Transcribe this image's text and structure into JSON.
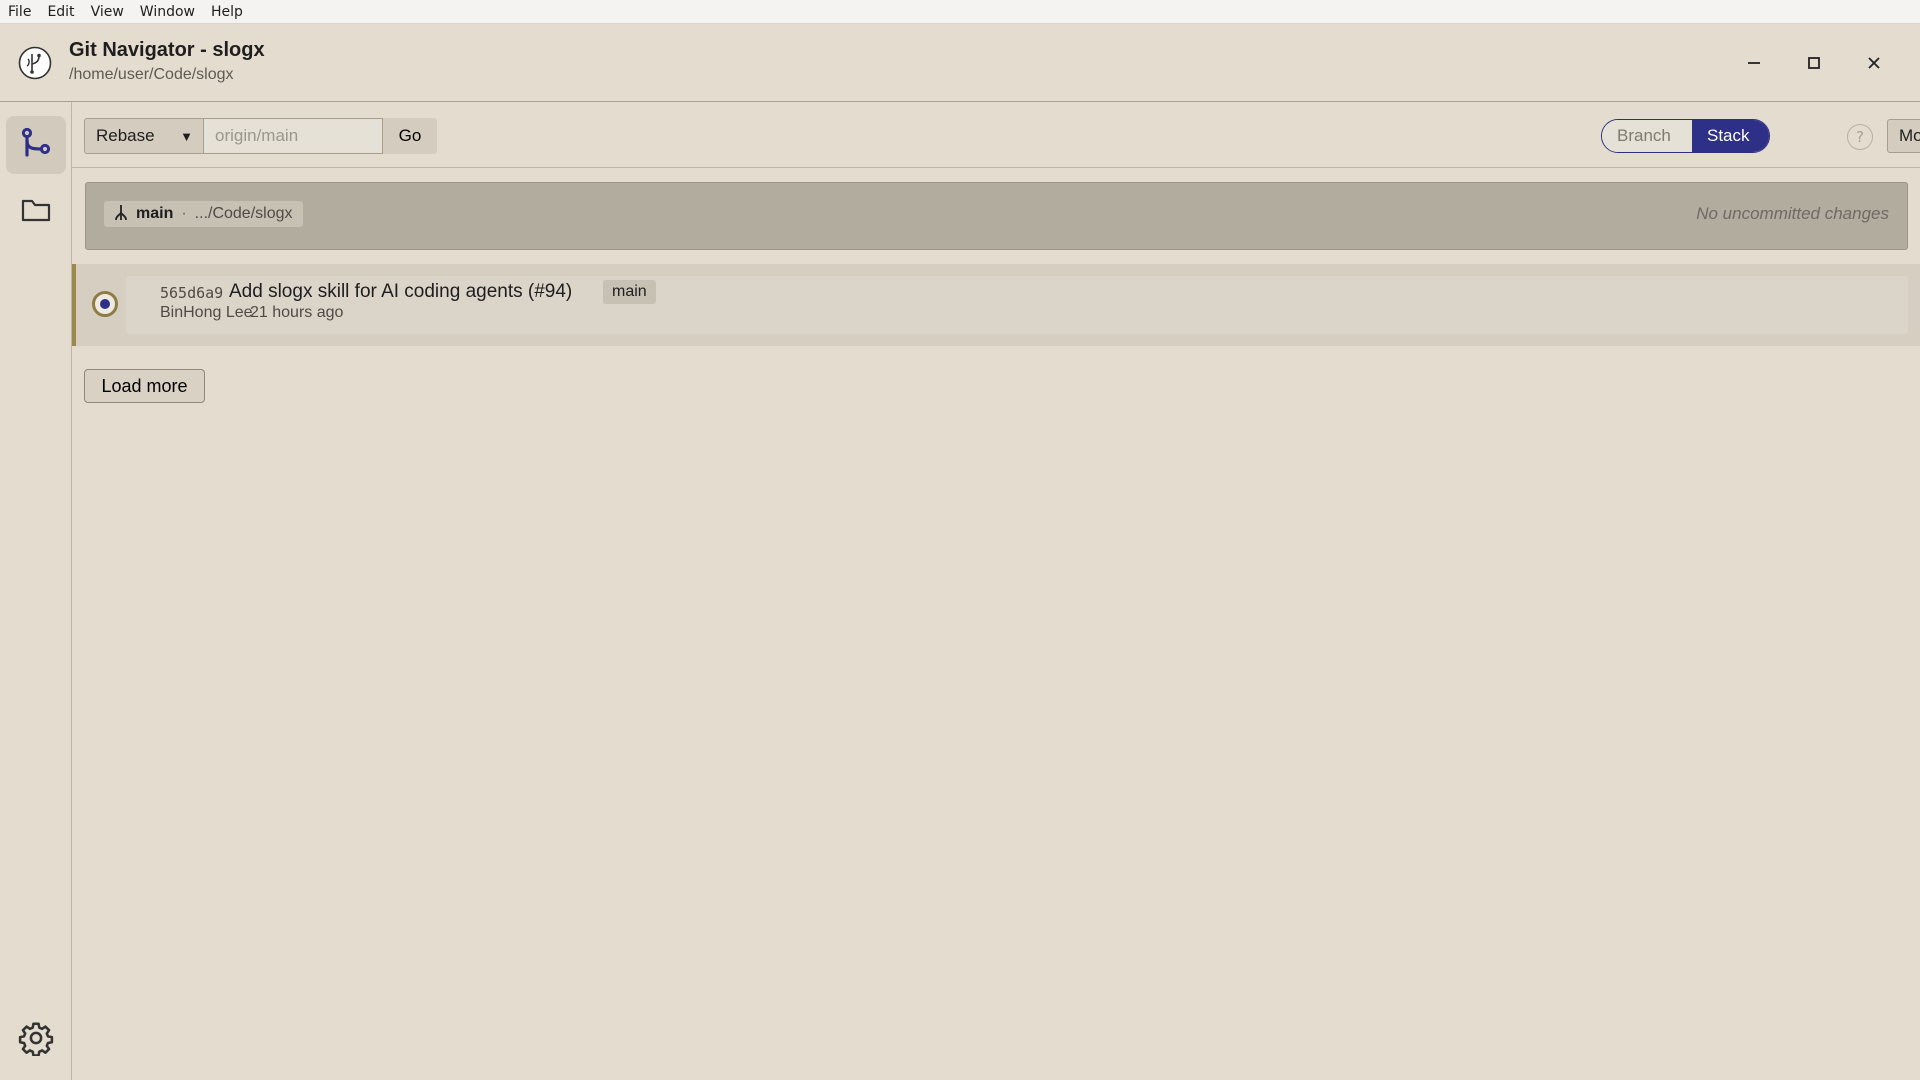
{
  "menubar": {
    "items": [
      "File",
      "Edit",
      "View",
      "Window",
      "Help"
    ]
  },
  "window": {
    "title": "Git Navigator - slogx",
    "path": "/home/user/Code/slogx"
  },
  "toolbar": {
    "mode": "Rebase",
    "target_placeholder": "origin/main",
    "go_label": "Go",
    "view_branch": "Branch",
    "view_stack": "Stack",
    "view_active": "Stack",
    "help_label": "?",
    "more_label": "More"
  },
  "workspace": {
    "branch": "main",
    "separator": "·",
    "path": ".../Code/slogx",
    "status": "No uncommitted changes"
  },
  "commits": [
    {
      "hash": "565d6a9",
      "message": "Add slogx skill for AI coding agents (#94)",
      "ref": "main",
      "author": "BinHong Lee",
      "time": "21 hours ago"
    }
  ],
  "load_more_label": "Load more",
  "colors": {
    "accent": "#2e2f86",
    "background": "#e3dccf",
    "commit_marker": "#9c8a4d"
  }
}
